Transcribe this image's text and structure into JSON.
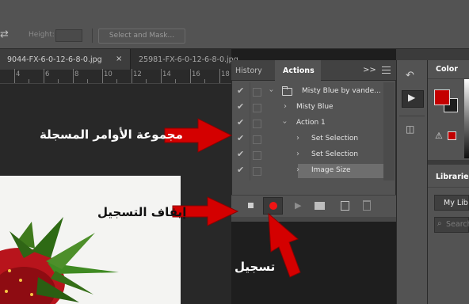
{
  "options_bar": {
    "height_label": "Height:",
    "select_mask_label": "Select and Mask..."
  },
  "doc_tabs": [
    {
      "label": "9044-FX-6-0-12-6-8-0.jpg",
      "close": "×"
    },
    {
      "label": "25981-FX-6-0-12-6-8-0.jpg"
    }
  ],
  "ruler": {
    "marks": [
      "4",
      "6",
      "8",
      "10",
      "12",
      "14",
      "16",
      "18"
    ]
  },
  "actions_panel": {
    "tabs": {
      "history": "History",
      "actions": "Actions"
    },
    "collapse": ">>",
    "rows": [
      {
        "label": "Misty Blue by vande..."
      },
      {
        "label": "Misty Blue"
      },
      {
        "label": "Action 1"
      },
      {
        "label": "Set Selection"
      },
      {
        "label": "Set Selection"
      },
      {
        "label": "Image Size"
      }
    ],
    "colors": {
      "record": "#ef1414",
      "highlight": "#6e6e6e"
    }
  },
  "color_panel": {
    "title": "Color",
    "foreground": "#c40000",
    "background": "#1e1e1e"
  },
  "libraries_panel": {
    "title": "Libraries",
    "selected": "My Lib",
    "search_placeholder": "Search"
  },
  "annotations": {
    "commands_group": "مجموعة الأوامر المسجلة",
    "stop_recording": "إيقاف التسجيل",
    "record": "تسجيل",
    "arrow_color": "#d40000"
  }
}
